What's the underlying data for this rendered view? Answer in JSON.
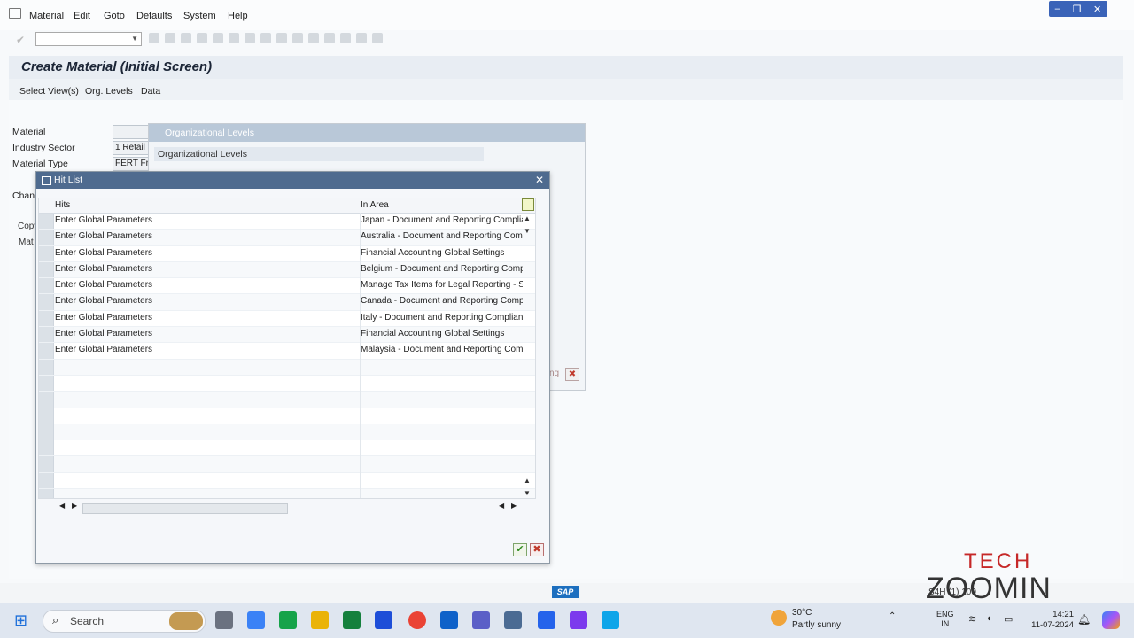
{
  "menu": [
    "Material",
    "Edit",
    "Goto",
    "Defaults",
    "System",
    "Help"
  ],
  "window_controls": [
    "–",
    "❐",
    "✕"
  ],
  "page_title": "Create Material (Initial Screen)",
  "app_toolbar": [
    "Select View(s)",
    "Org. Levels",
    "Data"
  ],
  "form": {
    "material_label": "Material",
    "industry_sector_label": "Industry Sector",
    "industry_sector_value": "1 Retail",
    "material_type_label": "Material Type",
    "material_type_value": "FERT Fr",
    "change_label": "Chang",
    "copy_tab": "Copy",
    "mat_tab": "Mat"
  },
  "org_dialog": {
    "title": "Organizational Levels",
    "subtitle": "Organizational Levels",
    "truncated_btn": "ng"
  },
  "hit_list": {
    "title": "Hit List",
    "col_hits": "Hits",
    "col_area": "In Area",
    "rows": [
      {
        "hit": "Enter Global Parameters",
        "area": "Japan - Document and Reporting Complian"
      },
      {
        "hit": "Enter Global Parameters",
        "area": "Australia - Document and Reporting Comp"
      },
      {
        "hit": "Enter Global Parameters",
        "area": "Financial Accounting Global Settings"
      },
      {
        "hit": "Enter Global Parameters",
        "area": "Belgium - Document and Reporting Compl"
      },
      {
        "hit": "Enter Global Parameters",
        "area": "Manage Tax Items for Legal Reporting - S"
      },
      {
        "hit": "Enter Global Parameters",
        "area": "Canada - Document and Reporting Compl"
      },
      {
        "hit": "Enter Global Parameters",
        "area": "Italy - Document and Reporting Complianc"
      },
      {
        "hit": "Enter Global Parameters",
        "area": "Financial Accounting Global Settings"
      },
      {
        "hit": "Enter Global Parameters",
        "area": "Malaysia - Document and Reporting Comp"
      }
    ]
  },
  "status_bar": {
    "sap_logo": "SAP",
    "system_info": "S4H (1) 100"
  },
  "watermark": {
    "line1": "TECH",
    "line2": "ZOOMIN"
  },
  "taskbar": {
    "search_placeholder": "Search",
    "weather_temp": "30°C",
    "weather_desc": "Partly sunny",
    "lang_line1": "ENG",
    "lang_line2": "IN",
    "time": "14:21",
    "date": "11-07-2024"
  },
  "colors": {
    "dialog_header": "#4f6b8f",
    "ok_green": "#2f8a1f",
    "cancel_red": "#c0392b",
    "watermark_red": "#c62828"
  }
}
